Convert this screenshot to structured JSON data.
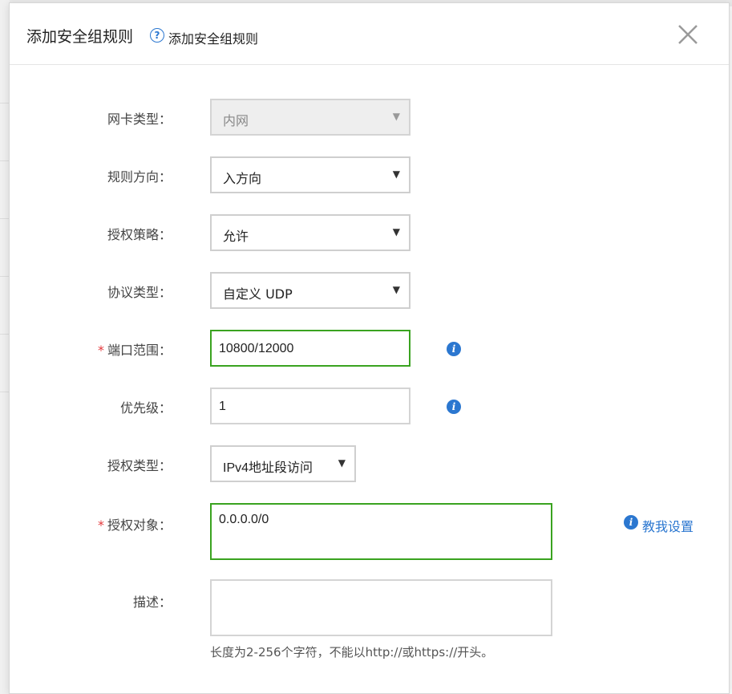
{
  "dialog": {
    "title": "添加安全组规则",
    "help_link": "添加安全组规则"
  },
  "form": {
    "nic_type": {
      "label": "网卡类型：",
      "value": "内网",
      "disabled": true
    },
    "direction": {
      "label": "规则方向：",
      "value": "入方向"
    },
    "policy": {
      "label": "授权策略：",
      "value": "允许"
    },
    "protocol": {
      "label": "协议类型：",
      "value": "自定义 UDP"
    },
    "port_range": {
      "label": "端口范围：",
      "required": "*",
      "value": "10800/12000"
    },
    "priority": {
      "label": "优先级：",
      "value": "1"
    },
    "auth_type": {
      "label": "授权类型：",
      "value": "IPv4地址段访问"
    },
    "auth_object": {
      "label": "授权对象：",
      "required": "*",
      "value": "0.0.0.0/0",
      "help_link": "教我设置"
    },
    "description": {
      "label": "描述：",
      "value": "",
      "hint": "长度为2-256个字符，不能以http://或https://开头。"
    }
  },
  "icons": {
    "help": "question-circle-icon",
    "close": "close-icon",
    "info": "info-icon",
    "dropdown": "caret-down-icon"
  },
  "colors": {
    "accent": "#2b77d0",
    "valid_border": "#3aa320",
    "required": "#e4393c"
  }
}
